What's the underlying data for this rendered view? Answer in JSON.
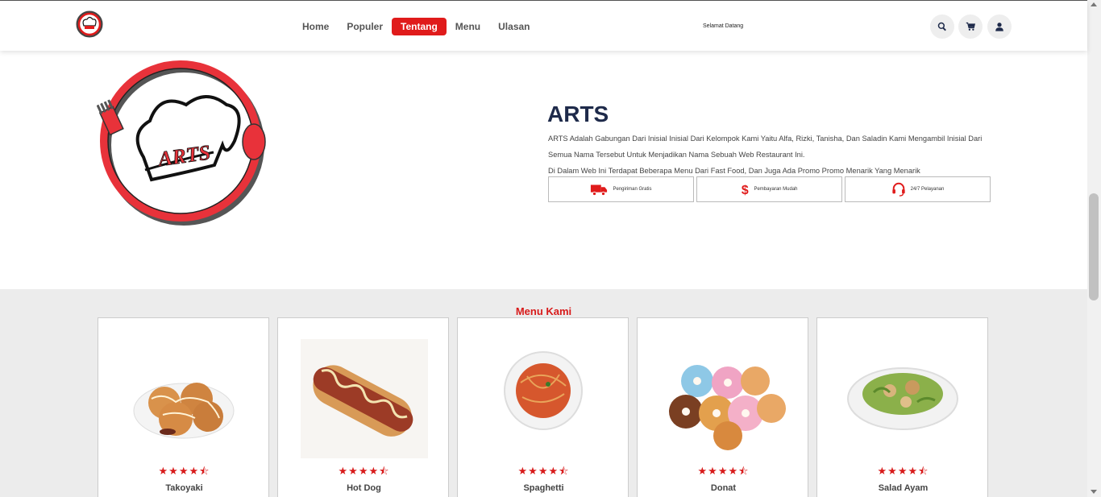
{
  "header": {
    "nav": [
      {
        "label": "Home",
        "active": false
      },
      {
        "label": "Populer",
        "active": false
      },
      {
        "label": "Tentang",
        "active": true
      },
      {
        "label": "Menu",
        "active": false
      },
      {
        "label": "Ulasan",
        "active": false
      }
    ],
    "welcome": "Selamat Datang",
    "icons": [
      "search-icon",
      "cart-icon",
      "user-icon"
    ]
  },
  "about": {
    "logo_text": "ARTS",
    "title": "ARTS",
    "paragraphs": [
      "ARTS Adalah Gabungan Dari Inisial Inisial Dari Kelompok Kami Yaitu Alfa, Rizki, Tanisha, Dan Saladin Kami Mengambil Inisial Dari Semua Nama Tersebut Untuk Menjadikan Nama Sebuah Web Restaurant Ini.",
      "Di Dalam Web Ini Terdapat Beberapa Menu Dari Fast Food, Dan Juga Ada Promo Promo Menarik Yang Menarik"
    ],
    "features": [
      {
        "label": "Pengiriman Gratis",
        "icon": "truck-icon"
      },
      {
        "label": "Pembayaran Mudah",
        "icon": "dollar-icon"
      },
      {
        "label": "24/7 Pelayanan",
        "icon": "headset-icon"
      }
    ]
  },
  "menu": {
    "title": "Menu Kami",
    "items": [
      {
        "name": "Takoyaki",
        "rating": 4.5
      },
      {
        "name": "Hot Dog",
        "rating": 4.5
      },
      {
        "name": "Spaghetti",
        "rating": 4.5
      },
      {
        "name": "Donat",
        "rating": 4.5
      },
      {
        "name": "Salad Ayam",
        "rating": 4.5
      }
    ]
  },
  "colors": {
    "accent": "#e01b1b",
    "navy": "#1e2a4a"
  }
}
